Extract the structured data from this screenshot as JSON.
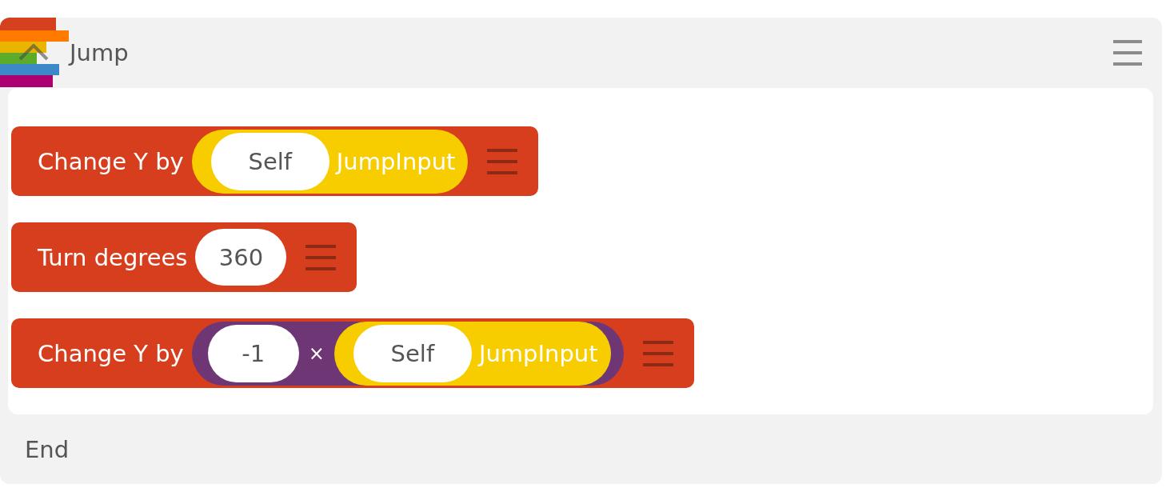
{
  "header": {
    "title": "Jump",
    "expanded": true
  },
  "blocks": [
    {
      "label": "Change Y by",
      "argument": {
        "kind": "variable",
        "object": "Self",
        "name": "JumpInput"
      }
    },
    {
      "label": "Turn degrees",
      "argument": {
        "kind": "number",
        "value": "360"
      }
    },
    {
      "label": "Change Y by",
      "argument": {
        "kind": "operation",
        "operator": "×",
        "left": {
          "kind": "number",
          "value": "-1"
        },
        "right": {
          "kind": "variable",
          "object": "Self",
          "name": "JumpInput"
        }
      }
    }
  ],
  "footer": {
    "label": "End"
  }
}
